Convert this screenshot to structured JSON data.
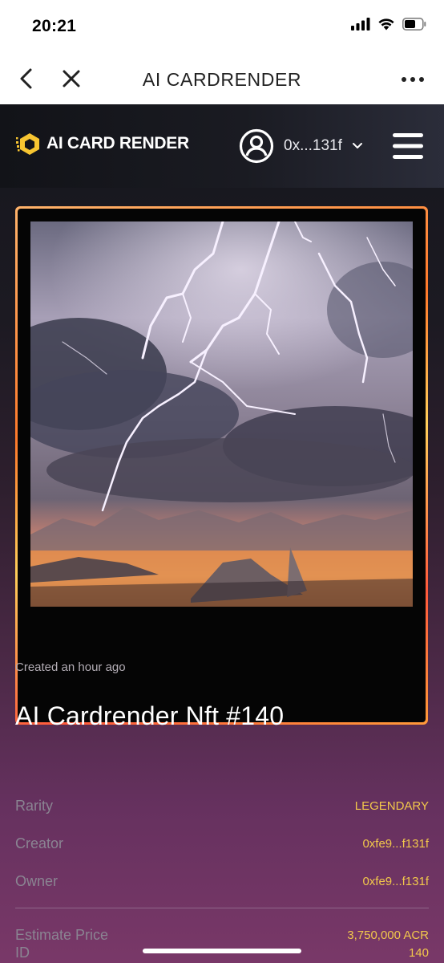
{
  "status_bar": {
    "time": "20:21"
  },
  "browser": {
    "title": "AI CARDRENDER"
  },
  "header": {
    "logo_text": "AI CARD RENDER",
    "wallet_address": "0x...131f"
  },
  "nft": {
    "created": "Created an hour ago",
    "title": "AI Cardrender Nft #140",
    "details": [
      {
        "label": "ID",
        "value": "140"
      },
      {
        "label": "Rarity",
        "value": "LEGENDARY"
      },
      {
        "label": "Creator",
        "value": "0xfe9...f131f"
      },
      {
        "label": "Owner",
        "value": "0xfe9...f131f"
      }
    ],
    "estimate": {
      "label": "Estimate Price",
      "value": "3,750,000 ACR"
    }
  },
  "colors": {
    "accent_gold": "#f2c84b",
    "frame_orange": "#ff7a2b",
    "header_bg": "#121318"
  }
}
